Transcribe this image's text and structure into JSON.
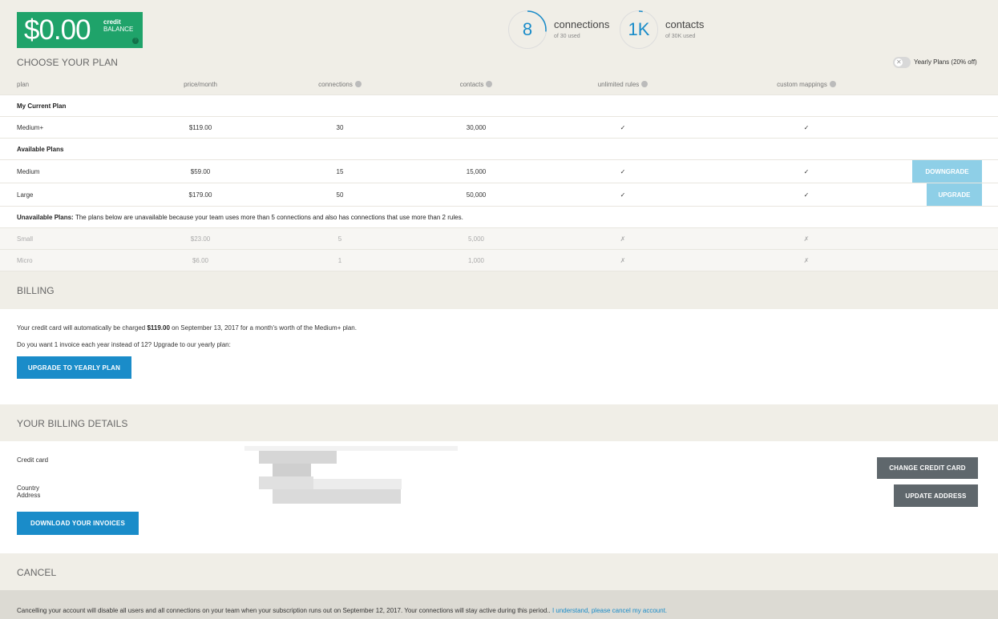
{
  "credit": {
    "amount": "$0.00",
    "label_top": "credit",
    "label_bottom": "BALANCE",
    "help": "?"
  },
  "stats": {
    "connections": {
      "value": "8",
      "label": "connections",
      "sub": "of 30 used",
      "fraction": 0.267
    },
    "contacts": {
      "value": "1K",
      "label": "contacts",
      "sub": "of 30K used",
      "fraction": 0.033
    }
  },
  "choose_plan": {
    "title": "CHOOSE YOUR PLAN",
    "yearly_toggle_label": "Yearly Plans (20% off)",
    "toggle_icon": "✕",
    "headers": {
      "plan": "plan",
      "price": "price/month",
      "connections": "connections",
      "contacts": "contacts",
      "rules": "unlimited rules",
      "mappings": "custom mappings"
    },
    "current_group": "My Current Plan",
    "current": {
      "plan": "Medium+",
      "price": "$119.00",
      "connections": "30",
      "contacts": "30,000",
      "rules": "✓",
      "mappings": "✓"
    },
    "available_group": "Available Plans",
    "available": [
      {
        "plan": "Medium",
        "price": "$59.00",
        "connections": "15",
        "contacts": "15,000",
        "rules": "✓",
        "mappings": "✓",
        "action": "DOWNGRADE"
      },
      {
        "plan": "Large",
        "price": "$179.00",
        "connections": "50",
        "contacts": "50,000",
        "rules": "✓",
        "mappings": "✓",
        "action": "UPGRADE"
      }
    ],
    "unavailable_label": "Unavailable Plans:",
    "unavailable_note": "The plans below are unavailable because your team uses more than 5 connections and also has connections that use more than 2 rules.",
    "unavailable": [
      {
        "plan": "Small",
        "price": "$23.00",
        "connections": "5",
        "contacts": "5,000",
        "rules": "✗",
        "mappings": "✗"
      },
      {
        "plan": "Micro",
        "price": "$6.00",
        "connections": "1",
        "contacts": "1,000",
        "rules": "✗",
        "mappings": "✗"
      }
    ]
  },
  "billing": {
    "title": "BILLING",
    "line1_a": "Your credit card will automatically be charged ",
    "line1_amount": "$119.00",
    "line1_b": " on September 13, 2017 for a month's worth of the Medium+ plan.",
    "line2": "Do you want 1 invoice each year instead of 12? Upgrade to our yearly plan:",
    "upgrade_button": "UPGRADE TO YEARLY PLAN"
  },
  "billing_details": {
    "title": "YOUR BILLING DETAILS",
    "credit_card_label": "Credit card",
    "country_label": "Country",
    "address_label": "Address",
    "change_card_button": "CHANGE CREDIT CARD",
    "update_address_button": "UPDATE ADDRESS",
    "download_button": "DOWNLOAD YOUR INVOICES"
  },
  "cancel": {
    "title": "CANCEL",
    "text": "Cancelling your account will disable all users and all connections on your team when your subscription runs out on September 12, 2017. Your connections will stay active during this period.. ",
    "link": "I understand, please cancel my account."
  }
}
